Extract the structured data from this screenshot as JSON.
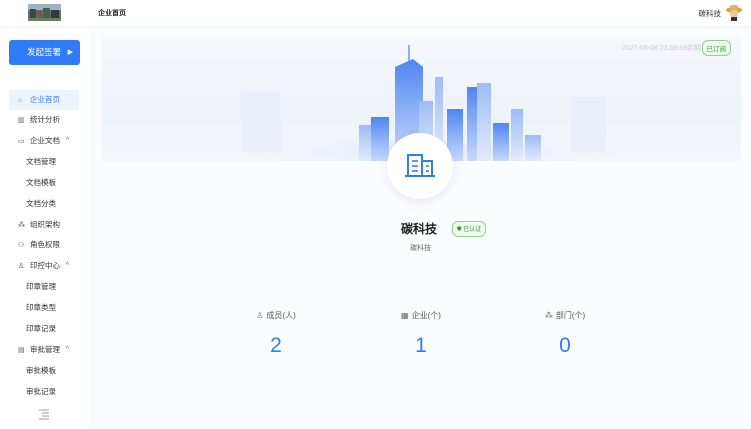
{
  "header": {
    "page_title": "企业首页",
    "user_name": "碳科技"
  },
  "sidebar": {
    "start_label": "发起签署",
    "items": [
      {
        "label": "企业首页",
        "icon": "home-icon"
      },
      {
        "label": "统计分析",
        "icon": "chart-icon"
      },
      {
        "label": "企业文档",
        "icon": "folder-icon"
      },
      {
        "label": "文档管理"
      },
      {
        "label": "文档模板"
      },
      {
        "label": "文档分类"
      },
      {
        "label": "组织架构",
        "icon": "org-icon"
      },
      {
        "label": "角色权限",
        "icon": "role-icon"
      },
      {
        "label": "印控中心",
        "icon": "user-icon"
      },
      {
        "label": "印章管理"
      },
      {
        "label": "印章类型"
      },
      {
        "label": "印章记录"
      },
      {
        "label": "审批管理",
        "icon": "clipboard-icon"
      },
      {
        "label": "审批模板"
      },
      {
        "label": "审批记录"
      }
    ]
  },
  "banner": {
    "expire_text": "2027-08-08 23:59:59到期",
    "status": "已订阅"
  },
  "company": {
    "name": "碳科技",
    "badge": "已认证",
    "subtitle": "碳科技"
  },
  "stats": [
    {
      "label": "成员(人)",
      "value": "2",
      "icon": "person-icon"
    },
    {
      "label": "企业(个)",
      "value": "1",
      "icon": "building-icon"
    },
    {
      "label": "部门(个)",
      "value": "0",
      "icon": "department-icon"
    }
  ],
  "colors": {
    "accent": "#2f7cf6",
    "verified_green": "#3a9a37"
  }
}
